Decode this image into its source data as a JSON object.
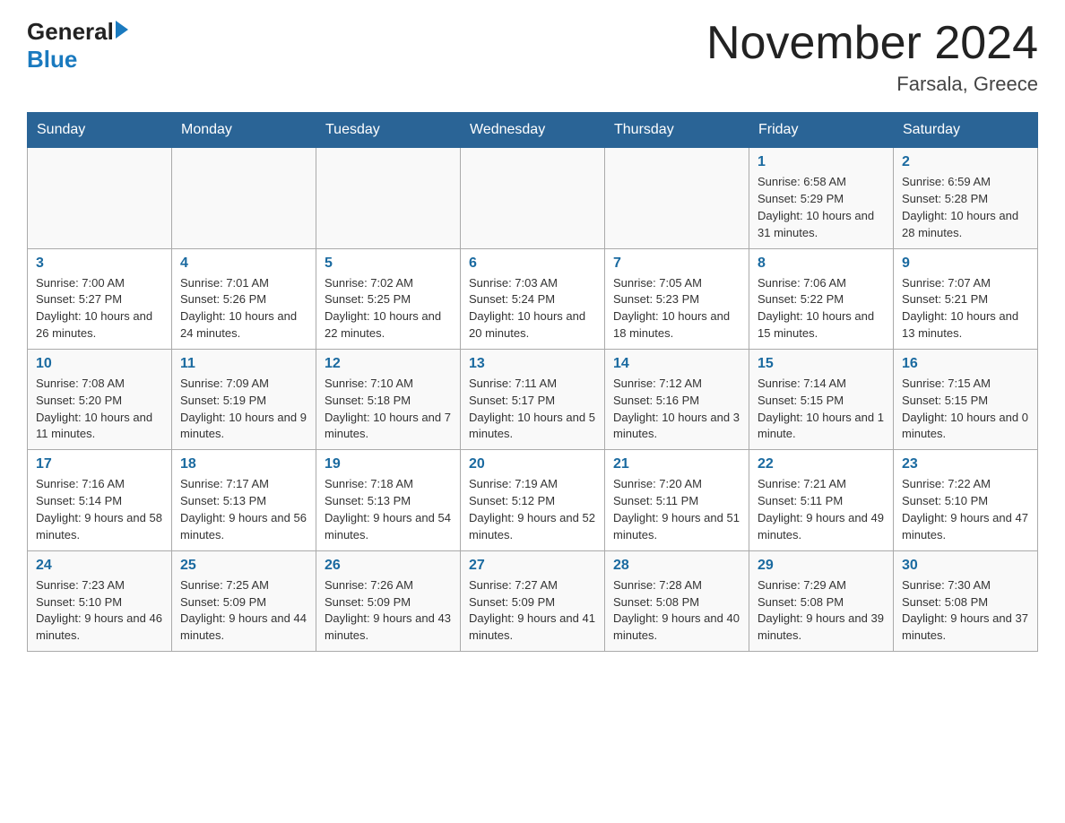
{
  "header": {
    "logo_general": "General",
    "logo_blue": "Blue",
    "month_year": "November 2024",
    "location": "Farsala, Greece"
  },
  "days_of_week": [
    "Sunday",
    "Monday",
    "Tuesday",
    "Wednesday",
    "Thursday",
    "Friday",
    "Saturday"
  ],
  "weeks": [
    [
      {
        "num": "",
        "info": ""
      },
      {
        "num": "",
        "info": ""
      },
      {
        "num": "",
        "info": ""
      },
      {
        "num": "",
        "info": ""
      },
      {
        "num": "",
        "info": ""
      },
      {
        "num": "1",
        "info": "Sunrise: 6:58 AM\nSunset: 5:29 PM\nDaylight: 10 hours and 31 minutes."
      },
      {
        "num": "2",
        "info": "Sunrise: 6:59 AM\nSunset: 5:28 PM\nDaylight: 10 hours and 28 minutes."
      }
    ],
    [
      {
        "num": "3",
        "info": "Sunrise: 7:00 AM\nSunset: 5:27 PM\nDaylight: 10 hours and 26 minutes."
      },
      {
        "num": "4",
        "info": "Sunrise: 7:01 AM\nSunset: 5:26 PM\nDaylight: 10 hours and 24 minutes."
      },
      {
        "num": "5",
        "info": "Sunrise: 7:02 AM\nSunset: 5:25 PM\nDaylight: 10 hours and 22 minutes."
      },
      {
        "num": "6",
        "info": "Sunrise: 7:03 AM\nSunset: 5:24 PM\nDaylight: 10 hours and 20 minutes."
      },
      {
        "num": "7",
        "info": "Sunrise: 7:05 AM\nSunset: 5:23 PM\nDaylight: 10 hours and 18 minutes."
      },
      {
        "num": "8",
        "info": "Sunrise: 7:06 AM\nSunset: 5:22 PM\nDaylight: 10 hours and 15 minutes."
      },
      {
        "num": "9",
        "info": "Sunrise: 7:07 AM\nSunset: 5:21 PM\nDaylight: 10 hours and 13 minutes."
      }
    ],
    [
      {
        "num": "10",
        "info": "Sunrise: 7:08 AM\nSunset: 5:20 PM\nDaylight: 10 hours and 11 minutes."
      },
      {
        "num": "11",
        "info": "Sunrise: 7:09 AM\nSunset: 5:19 PM\nDaylight: 10 hours and 9 minutes."
      },
      {
        "num": "12",
        "info": "Sunrise: 7:10 AM\nSunset: 5:18 PM\nDaylight: 10 hours and 7 minutes."
      },
      {
        "num": "13",
        "info": "Sunrise: 7:11 AM\nSunset: 5:17 PM\nDaylight: 10 hours and 5 minutes."
      },
      {
        "num": "14",
        "info": "Sunrise: 7:12 AM\nSunset: 5:16 PM\nDaylight: 10 hours and 3 minutes."
      },
      {
        "num": "15",
        "info": "Sunrise: 7:14 AM\nSunset: 5:15 PM\nDaylight: 10 hours and 1 minute."
      },
      {
        "num": "16",
        "info": "Sunrise: 7:15 AM\nSunset: 5:15 PM\nDaylight: 10 hours and 0 minutes."
      }
    ],
    [
      {
        "num": "17",
        "info": "Sunrise: 7:16 AM\nSunset: 5:14 PM\nDaylight: 9 hours and 58 minutes."
      },
      {
        "num": "18",
        "info": "Sunrise: 7:17 AM\nSunset: 5:13 PM\nDaylight: 9 hours and 56 minutes."
      },
      {
        "num": "19",
        "info": "Sunrise: 7:18 AM\nSunset: 5:13 PM\nDaylight: 9 hours and 54 minutes."
      },
      {
        "num": "20",
        "info": "Sunrise: 7:19 AM\nSunset: 5:12 PM\nDaylight: 9 hours and 52 minutes."
      },
      {
        "num": "21",
        "info": "Sunrise: 7:20 AM\nSunset: 5:11 PM\nDaylight: 9 hours and 51 minutes."
      },
      {
        "num": "22",
        "info": "Sunrise: 7:21 AM\nSunset: 5:11 PM\nDaylight: 9 hours and 49 minutes."
      },
      {
        "num": "23",
        "info": "Sunrise: 7:22 AM\nSunset: 5:10 PM\nDaylight: 9 hours and 47 minutes."
      }
    ],
    [
      {
        "num": "24",
        "info": "Sunrise: 7:23 AM\nSunset: 5:10 PM\nDaylight: 9 hours and 46 minutes."
      },
      {
        "num": "25",
        "info": "Sunrise: 7:25 AM\nSunset: 5:09 PM\nDaylight: 9 hours and 44 minutes."
      },
      {
        "num": "26",
        "info": "Sunrise: 7:26 AM\nSunset: 5:09 PM\nDaylight: 9 hours and 43 minutes."
      },
      {
        "num": "27",
        "info": "Sunrise: 7:27 AM\nSunset: 5:09 PM\nDaylight: 9 hours and 41 minutes."
      },
      {
        "num": "28",
        "info": "Sunrise: 7:28 AM\nSunset: 5:08 PM\nDaylight: 9 hours and 40 minutes."
      },
      {
        "num": "29",
        "info": "Sunrise: 7:29 AM\nSunset: 5:08 PM\nDaylight: 9 hours and 39 minutes."
      },
      {
        "num": "30",
        "info": "Sunrise: 7:30 AM\nSunset: 5:08 PM\nDaylight: 9 hours and 37 minutes."
      }
    ]
  ]
}
